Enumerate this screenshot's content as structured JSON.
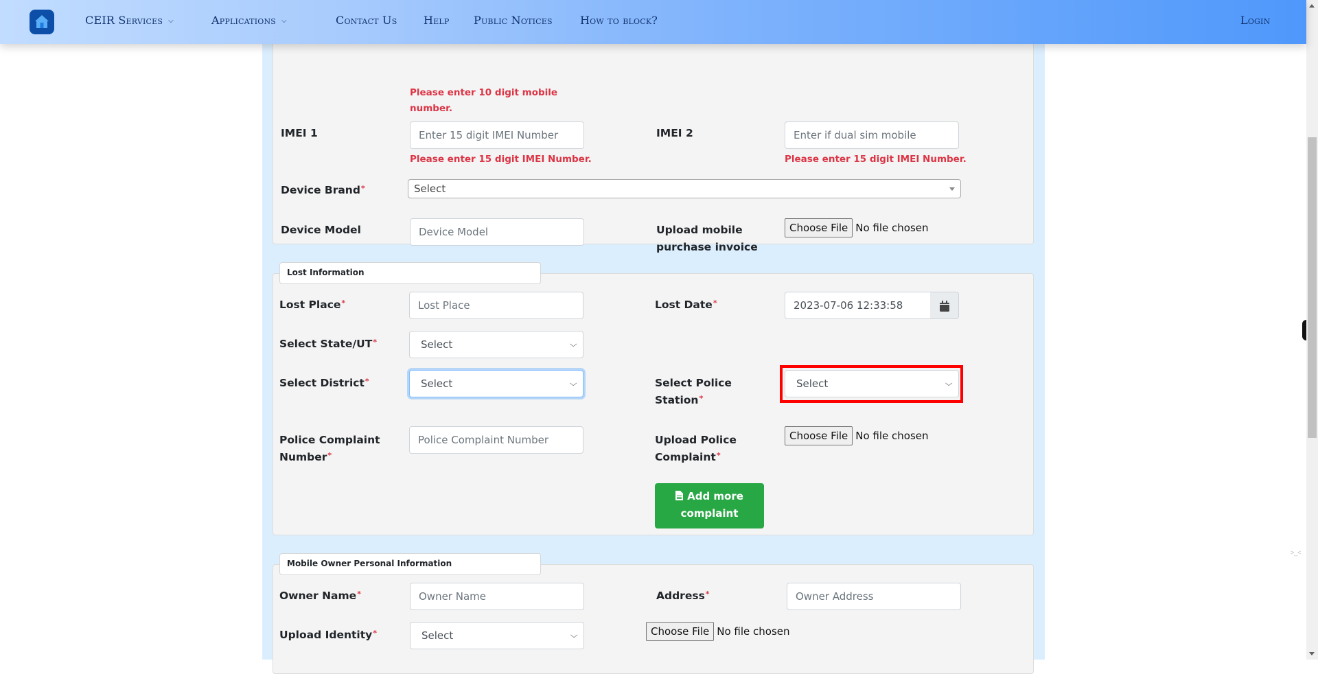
{
  "nav": {
    "home_icon": "home-icon",
    "items": [
      {
        "label": "CEIR Services",
        "has_caret": true
      },
      {
        "label": "Applications",
        "has_caret": true
      },
      {
        "label": "Contact Us"
      },
      {
        "label": "Help"
      },
      {
        "label": "Public Notices"
      },
      {
        "label": "How to block?"
      }
    ],
    "login": "Login",
    "caret": "⌄"
  },
  "device_section": {
    "mobile_error": "Please enter 10 digit mobile number.",
    "imei1": {
      "label": "IMEI 1",
      "placeholder": "Enter 15 digit IMEI Number",
      "error": "Please enter 15 digit IMEI Number."
    },
    "imei2": {
      "label": "IMEI 2",
      "placeholder": "Enter if dual sim mobile",
      "error": "Please enter 15 digit IMEI Number."
    },
    "brand": {
      "label": "Device Brand",
      "value": "Select"
    },
    "model": {
      "label": "Device Model",
      "placeholder": "Device Model"
    },
    "invoice": {
      "label_line1": "Upload mobile",
      "label_line2": "purchase invoice",
      "button": "Choose File",
      "status": "No file chosen"
    }
  },
  "lost_section": {
    "legend": "Lost Information",
    "lost_place": {
      "label": "Lost Place",
      "placeholder": "Lost Place"
    },
    "lost_date": {
      "label": "Lost Date",
      "value": "2023-07-06 12:33:58",
      "icon": "calendar-icon"
    },
    "state": {
      "label": "Select State/UT",
      "value": "Select"
    },
    "district": {
      "label": "Select District",
      "value": "Select"
    },
    "police_station": {
      "label_line1": "Select Police",
      "label_line2": "Station",
      "value": "Select"
    },
    "complaint_number": {
      "label_line1": "Police Complaint",
      "label_line2": "Number",
      "placeholder": "Police Complaint Number"
    },
    "complaint_upload": {
      "label_line1": "Upload Police",
      "label_line2": "Complaint",
      "button": "Choose File",
      "status": "No file chosen"
    },
    "add_more": {
      "line1": "Add more",
      "line2": "complaint",
      "icon": "file-icon",
      "color": "#28a745"
    }
  },
  "owner_section": {
    "legend": "Mobile Owner Personal Information",
    "owner_name": {
      "label": "Owner Name",
      "placeholder": "Owner Name"
    },
    "address": {
      "label": "Address",
      "placeholder": "Owner Address"
    },
    "identity": {
      "label": "Upload Identity",
      "value": "Select",
      "button": "Choose File",
      "status": "No file chosen"
    }
  },
  "required_mark": "*",
  "colors": {
    "error": "#dc3545",
    "highlight": "#ff0000",
    "nav_text": "#10326e"
  }
}
